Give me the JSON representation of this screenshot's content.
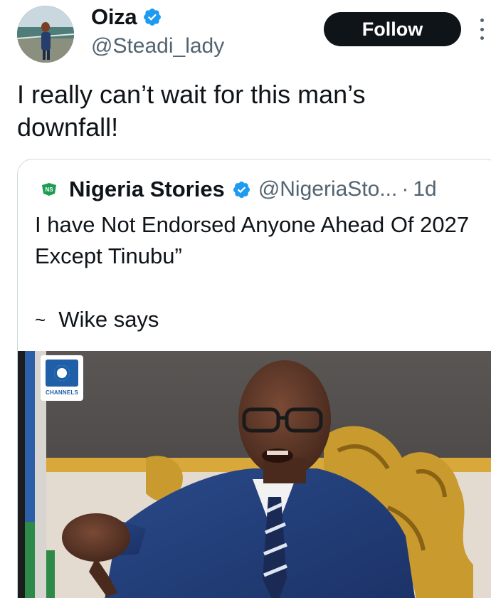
{
  "tweet": {
    "author_name": "Oiza",
    "author_handle": "@Steadi_lady",
    "follow_label": "Follow",
    "text": "I really can’t wait for this man’s downfall!"
  },
  "quote": {
    "author_name": "Nigeria Stories",
    "author_handle": "@NigeriaSto...",
    "separator": "·",
    "time": "1d",
    "text": "I have Not Endorsed Anyone Ahead Of 2027 Except Tinubu”",
    "signature_prefix": "~",
    "signature": "Wike says",
    "media": {
      "watermark": "CHANNELS"
    }
  },
  "icons": {
    "verified": "verified-badge-icon",
    "more": "more-options-icon",
    "source_logo": "nigeria-stories-logo-icon"
  },
  "colors": {
    "accent": "#1d9bf0",
    "text": "#0f1419",
    "muted": "#536471",
    "button": "#0f1419"
  }
}
